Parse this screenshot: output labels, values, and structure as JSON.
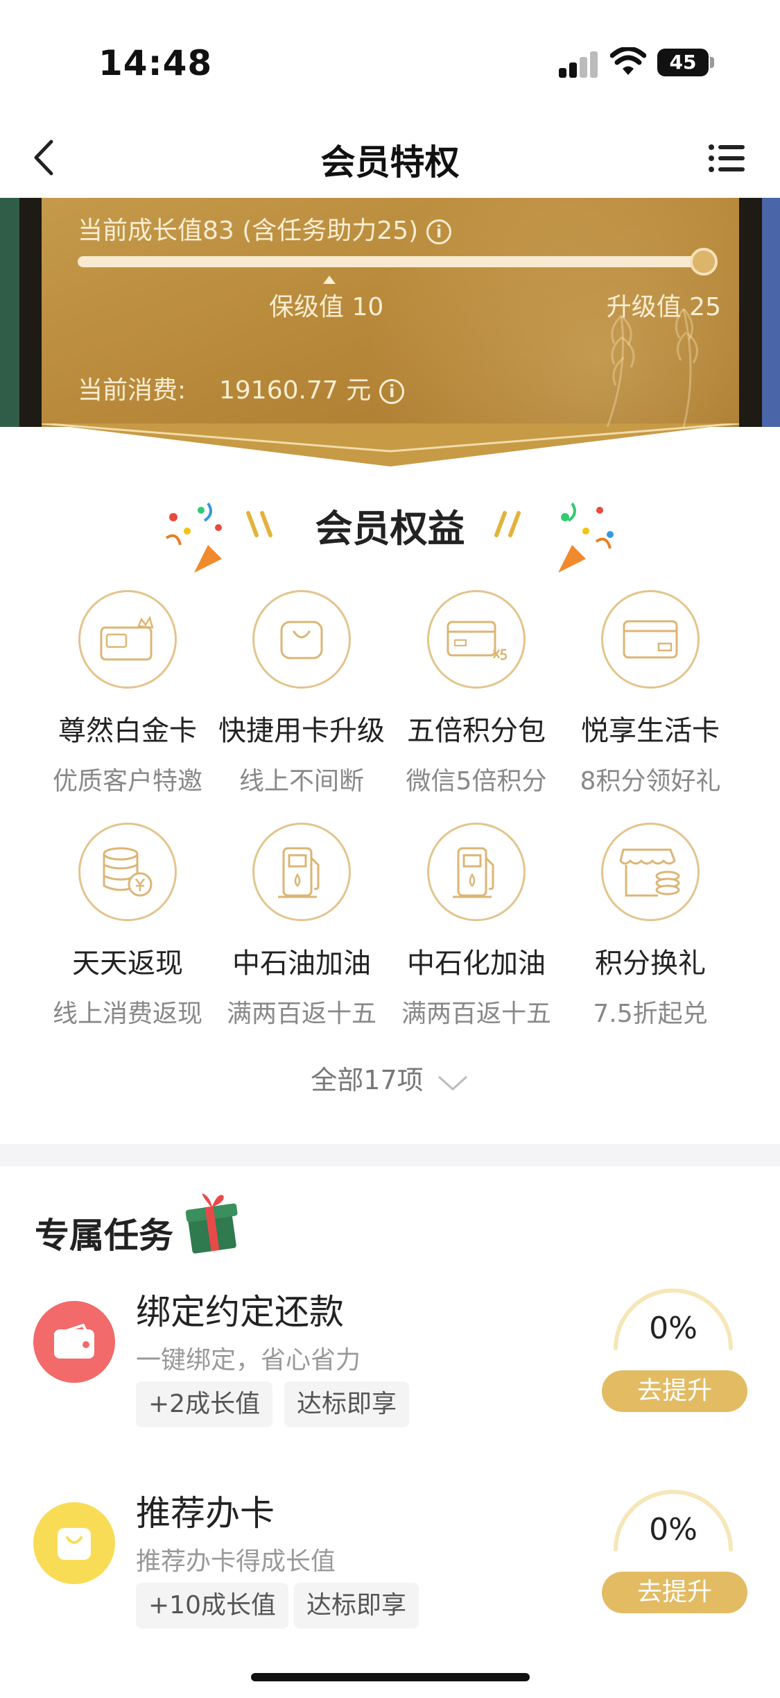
{
  "status_bar": {
    "time": "14:48",
    "battery": "45"
  },
  "nav": {
    "title": "会员特权",
    "back_icon": "chevron-left-icon",
    "menu_icon": "list-menu-icon"
  },
  "growth": {
    "text": "当前成长值83 (含任务助力25)",
    "progress": 1.0,
    "keep_level": "保级值 10",
    "upgrade_level": "升级值 25",
    "consume_label": "当前消费:",
    "consume_value": "19160.77 元",
    "card_color": "#b98a3b"
  },
  "benefits": {
    "title": "会员权益",
    "items": [
      {
        "name": "尊然白金卡",
        "desc": "优质客户特邀",
        "icon": "platinum-card-icon"
      },
      {
        "name": "快捷用卡升级",
        "desc": "线上不间断",
        "icon": "shopping-bag-icon"
      },
      {
        "name": "五倍积分包",
        "desc": "微信5倍积分",
        "icon": "card-x5-icon"
      },
      {
        "name": "悦享生活卡",
        "desc": "8积分领好礼",
        "icon": "life-card-icon"
      },
      {
        "name": "天天返现",
        "desc": "线上消费返现",
        "icon": "coin-stack-cashback-icon"
      },
      {
        "name": "中石油加油",
        "desc": "满两百返十五",
        "icon": "fuel-pump-icon"
      },
      {
        "name": "中石化加油",
        "desc": "满两百返十五",
        "icon": "fuel-pump-icon"
      },
      {
        "name": "积分换礼",
        "desc": "7.5折起兑",
        "icon": "store-coins-icon"
      }
    ],
    "all_items": "全部17项",
    "accent": "#e3c48c"
  },
  "tasks": {
    "title": "专属任务",
    "items": [
      {
        "title": "绑定约定还款",
        "subtitle": "一键绑定，省心省力",
        "tags": [
          "+2成长值",
          "达标即享"
        ],
        "progress": "0%",
        "button": "去提升",
        "icon": "wallet-icon",
        "icon_color": "#f36c6c"
      },
      {
        "title": "推荐办卡",
        "subtitle": "推荐办卡得成长值",
        "tags": [
          "+10成长值",
          "达标即享"
        ],
        "progress": "0%",
        "button": "去提升",
        "icon": "shopping-bag-icon",
        "icon_color": "#f7d44a"
      }
    ],
    "button_color": "#e2bb63"
  }
}
